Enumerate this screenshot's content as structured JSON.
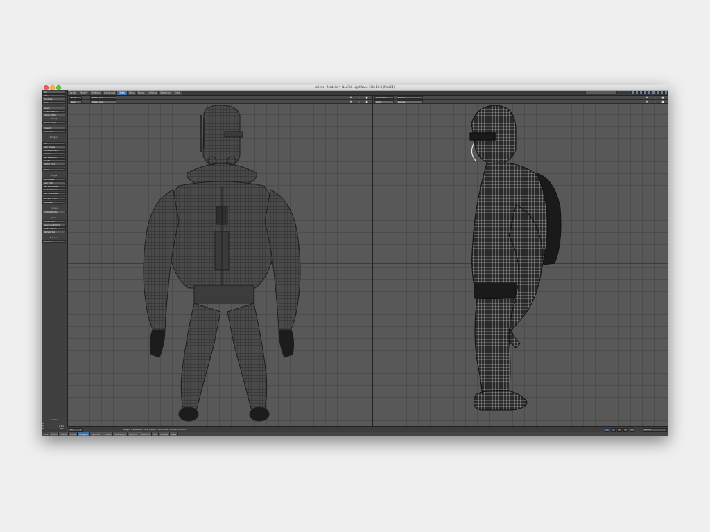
{
  "window": {
    "title": "all.lwo - Modeler™ NewTek LightWave 10th 10.0 (Mac64)"
  },
  "menu_tabs": [
    {
      "label": "Create"
    },
    {
      "label": "Modify"
    },
    {
      "label": "Multiply"
    },
    {
      "label": "Construct"
    },
    {
      "label": "Detail"
    },
    {
      "label": "Map"
    },
    {
      "label": "Setup"
    },
    {
      "label": "Utilities"
    },
    {
      "label": "Selection"
    },
    {
      "label": "View"
    }
  ],
  "active_menu_tab": "Detail",
  "sidebar": {
    "items": [
      {
        "kind": "btn",
        "label": "File"
      },
      {
        "kind": "btn",
        "label": "Edit"
      },
      {
        "kind": "btn",
        "label": "Windows"
      },
      {
        "kind": "btn",
        "label": "Help"
      },
      {
        "kind": "gap"
      },
      {
        "kind": "btn",
        "label": "Select"
      },
      {
        "kind": "btn",
        "label": "Surface Editor"
      },
      {
        "kind": "btn",
        "label": "Image Editor"
      },
      {
        "kind": "head",
        "label": "Points"
      },
      {
        "kind": "btn",
        "label": "Merge Points"
      },
      {
        "kind": "gap"
      },
      {
        "kind": "btn",
        "label": "Unweld"
      },
      {
        "kind": "btn",
        "label": "Set Value"
      },
      {
        "kind": "gap"
      },
      {
        "kind": "head",
        "label": "Polygons"
      },
      {
        "kind": "gap"
      },
      {
        "kind": "btn",
        "label": "Flip"
      },
      {
        "kind": "btn",
        "label": "Spin Quads"
      },
      {
        "kind": "btn",
        "label": "Unify Normals"
      },
      {
        "kind": "btn",
        "label": "Set Cint"
      },
      {
        "kind": "btn",
        "label": "Set Subpatch"
      },
      {
        "kind": "btn",
        "label": "Set FC"
      },
      {
        "kind": "btn",
        "label": "Switch Cont"
      },
      {
        "kind": "gap"
      },
      {
        "kind": "btn",
        "label": "More"
      },
      {
        "kind": "gap"
      },
      {
        "kind": "head",
        "label": "Edges"
      },
      {
        "kind": "btn",
        "label": "Add Edges"
      },
      {
        "kind": "btn",
        "label": "Spin Edge"
      },
      {
        "kind": "btn",
        "label": "Set Sharpness"
      },
      {
        "kind": "btn",
        "label": "Inc Sharpness"
      },
      {
        "kind": "btn",
        "label": "Dec Sharpness"
      },
      {
        "kind": "gap"
      },
      {
        "kind": "btn",
        "label": "PloyTrim Edges"
      },
      {
        "kind": "btn",
        "label": "Bandsaw"
      },
      {
        "kind": "gap"
      },
      {
        "kind": "head",
        "label": "Curves"
      },
      {
        "kind": "btn",
        "label": "Control Points"
      },
      {
        "kind": "gap"
      },
      {
        "kind": "head",
        "label": "Parts"
      },
      {
        "kind": "btn",
        "label": "Create Part"
      },
      {
        "kind": "btn",
        "label": "Select Parts Part"
      },
      {
        "kind": "btn",
        "label": "Split on Parts"
      },
      {
        "kind": "btn",
        "label": "Parts to Sub"
      },
      {
        "kind": "gap"
      },
      {
        "kind": "head",
        "label": "Measure"
      },
      {
        "kind": "btn",
        "label": "Measure"
      }
    ],
    "position": {
      "label": "Position",
      "x": "X",
      "y": "Y",
      "y_value": "2.7 m",
      "z": "Z",
      "z_value": "89 m"
    }
  },
  "viewports": {
    "left": {
      "top_view": "Front",
      "top_mode": "Hidden Line",
      "bottom_view": "Back",
      "bottom_mode": "Hidden Line",
      "icons": [
        "move-icon",
        "zoom-icon",
        "maximize-icon"
      ]
    },
    "right": {
      "top_view": "Perspective",
      "top_mode": "Texture",
      "bottom_view": "Right",
      "bottom_mode": "Texture",
      "icons": [
        "move-icon",
        "zoom-icon",
        "maximize-icon"
      ]
    }
  },
  "status": {
    "layer_label": "Lvl",
    "layer_value": "1",
    "hint": "Drag to translate in view plane. CTRL forces one axis motion.",
    "small_buttons": [
      "B",
      "F",
      "P",
      "S",
      "SR"
    ],
    "mode": "Normal"
  },
  "bottom_bar": [
    {
      "label": "Scale",
      "kind": "label"
    },
    {
      "label": "100 m",
      "kind": "item"
    },
    {
      "label": "Points",
      "kind": "item"
    },
    {
      "label": "Edges",
      "kind": "item"
    },
    {
      "label": "Polygons",
      "kind": "item",
      "active": true
    },
    {
      "label": "Symmetry",
      "kind": "item"
    },
    {
      "label": "Modes",
      "kind": "item"
    },
    {
      "label": "Spline Type",
      "kind": "item"
    },
    {
      "label": "Numeric",
      "kind": "item"
    },
    {
      "label": "Statistics",
      "kind": "item"
    },
    {
      "label": "Info",
      "kind": "item"
    },
    {
      "label": "Surface",
      "kind": "item"
    },
    {
      "label": "Make",
      "kind": "item"
    }
  ],
  "colors": {
    "accent": "#3f6fa8",
    "viewport_bg": "#585858",
    "wire_dark": "#2a2a2a",
    "wire_light": "#e6e6e6",
    "strip_yellow": "#d4c01f"
  }
}
